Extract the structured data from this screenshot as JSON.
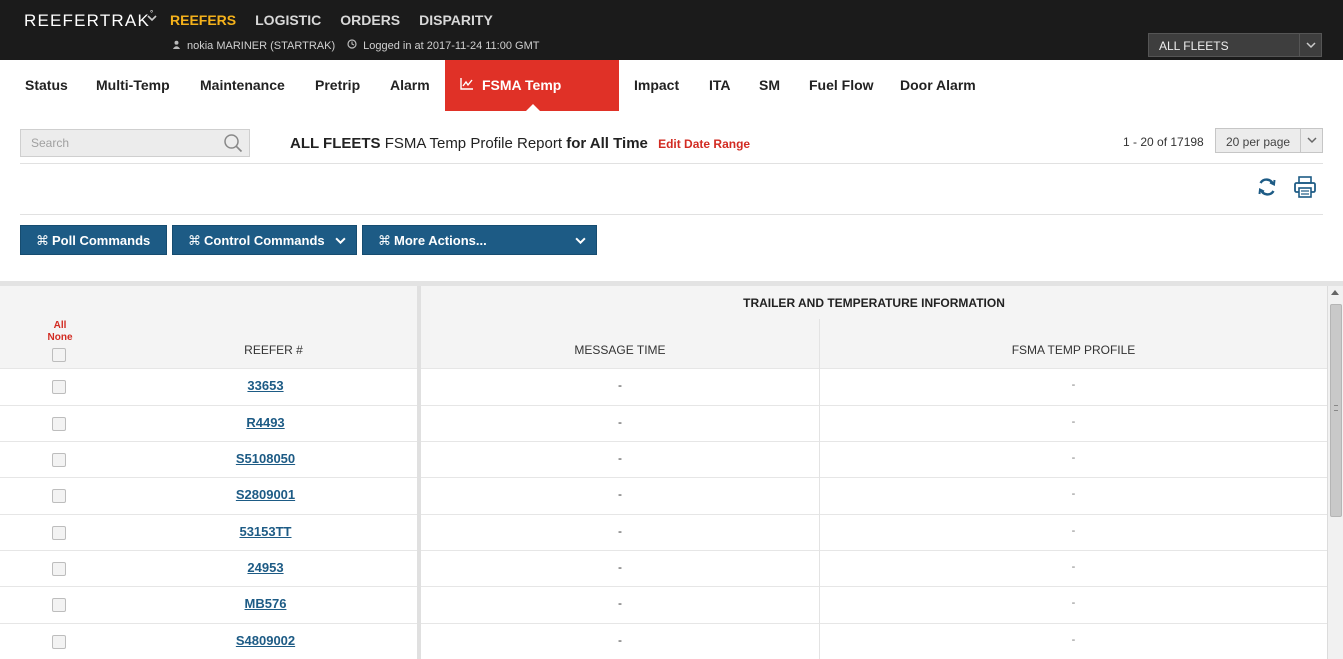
{
  "header": {
    "brand": "REEFERTRAK",
    "brand_mark": "°",
    "nav": [
      {
        "label": "REEFERS",
        "active": true
      },
      {
        "label": "LOGISTIC",
        "active": false
      },
      {
        "label": "ORDERS",
        "active": false
      },
      {
        "label": "DISPARITY",
        "active": false
      }
    ],
    "user": "nokia MARINER (STARTRAK)",
    "login": "Logged in at 2017-11-24 11:00 GMT",
    "fleet_select": "ALL FLEETS",
    "accent_color": "#f5b21b"
  },
  "tabs": [
    {
      "label": "Status"
    },
    {
      "label": "Multi-Temp"
    },
    {
      "label": "Maintenance"
    },
    {
      "label": "Pretrip"
    },
    {
      "label": "Alarm"
    },
    {
      "label": "FSMA Temp Profile",
      "active": true
    },
    {
      "label": "Impact"
    },
    {
      "label": "ITA"
    },
    {
      "label": "SM"
    },
    {
      "label": "Fuel Flow"
    },
    {
      "label": "Door Alarm"
    }
  ],
  "toolbar": {
    "search_placeholder": "Search",
    "report_fleet": "ALL FLEETS",
    "report_name": "FSMA Temp Profile Report",
    "report_period": "for All Time",
    "edit_date_range": "Edit Date Range",
    "pagination": "1 - 20 of 17198",
    "per_page": "20 per page",
    "buttons": {
      "poll": "Poll Commands",
      "control": "Control Commands",
      "more": "More Actions..."
    },
    "cmd_glyph": "⌘",
    "button_color": "#1d5b85",
    "active_tab_color": "#e03127"
  },
  "table": {
    "select_all": "All",
    "select_none": "None",
    "group_header": "TRAILER AND TEMPERATURE INFORMATION",
    "columns": [
      "REEFER #",
      "MESSAGE TIME",
      "FSMA TEMP PROFILE"
    ],
    "rows": [
      {
        "reefer": "33653",
        "message_time": "-",
        "fsma": "-"
      },
      {
        "reefer": "R4493",
        "message_time": "-",
        "fsma": "-"
      },
      {
        "reefer": "S5108050",
        "message_time": "-",
        "fsma": "-"
      },
      {
        "reefer": "S2809001",
        "message_time": "-",
        "fsma": "-"
      },
      {
        "reefer": "53153TT",
        "message_time": "-",
        "fsma": "-"
      },
      {
        "reefer": "24953",
        "message_time": "-",
        "fsma": "-"
      },
      {
        "reefer": "MB576",
        "message_time": "-",
        "fsma": "-"
      },
      {
        "reefer": "S4809002",
        "message_time": "-",
        "fsma": "-"
      }
    ]
  }
}
